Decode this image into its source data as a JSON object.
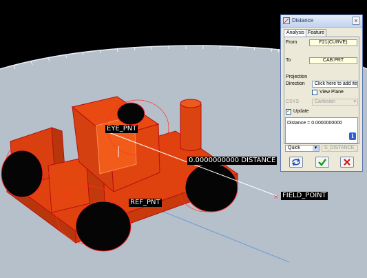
{
  "viewport": {
    "labels": {
      "eye_pnt": "EYE_PNT",
      "distance": "0.0000000000  DISTANCE",
      "field_point": "FIELD_POINT",
      "ref_pnt": "REF_PNT"
    },
    "colors": {
      "background": "#000000",
      "floor": "#b6c1cc",
      "model": "#e04410",
      "model_edges": "#cc1010",
      "wheels": "#050505",
      "measure_line": "#ffffff",
      "axis_line": "#5588cc"
    }
  },
  "dialog": {
    "title": "Distance",
    "close": "×",
    "tabs": [
      "Analysis",
      "Feature"
    ],
    "active_tab": "Analysis",
    "from_label": "From",
    "from_value": "F21(CURVE)",
    "to_label": "To",
    "to_value": "CAB:PRT",
    "projection_label": "Projection",
    "direction_label": "Direction",
    "direction_placeholder": "Click here to add ite",
    "view_plane_label": "View Plane",
    "view_plane_checked": false,
    "csys_label": "CSYS",
    "csys_value": "Cartesian",
    "update_label": "Update",
    "update_checked": true,
    "result_text": "Distance = 0.0000000000",
    "info_icon": "i",
    "mode_value": "Quick",
    "name_value": "S_DISTANCE_1",
    "buttons": {
      "repeat_icon": "repeat-icon",
      "ok_icon": "checkmark-icon",
      "cancel_icon": "cancel-x-icon"
    }
  }
}
